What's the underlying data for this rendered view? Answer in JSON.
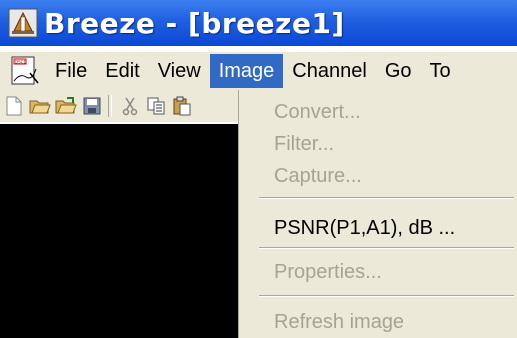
{
  "window": {
    "title": "Breeze - [breeze1]",
    "title_bar_color": "#1f5fe0"
  },
  "menubar": {
    "items": [
      {
        "label": "File"
      },
      {
        "label": "Edit"
      },
      {
        "label": "View"
      },
      {
        "label": "Image",
        "active": true
      },
      {
        "label": "Channel"
      },
      {
        "label": "Go"
      },
      {
        "label": "To"
      }
    ],
    "active_color": "#316ac5"
  },
  "toolbar": {
    "icons": [
      "new-file-icon",
      "open-folder-icon",
      "open-folder-green-icon",
      "save-icon",
      "cut-icon",
      "copy-icon",
      "paste-icon"
    ]
  },
  "image_menu": {
    "items": [
      {
        "label": "Convert...",
        "enabled": false
      },
      {
        "label": "Filter...",
        "enabled": false
      },
      {
        "label": "Capture...",
        "enabled": false
      },
      {
        "label": "PSNR(P1,A1), dB ...",
        "enabled": true
      },
      {
        "label": "Properties...",
        "enabled": false
      },
      {
        "label": "Refresh image",
        "enabled": false
      }
    ]
  }
}
